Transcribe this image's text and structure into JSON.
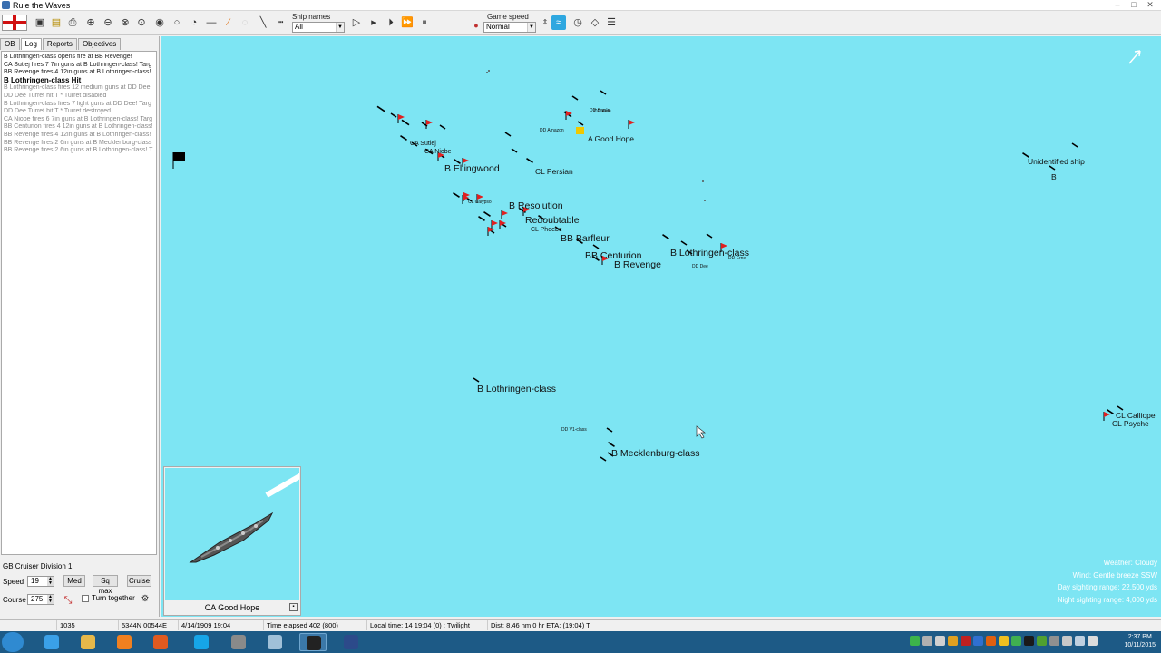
{
  "window": {
    "title": "Rule the Waves"
  },
  "toolbar": {
    "ship_names_label": "Ship names",
    "ship_names_value": "All",
    "game_speed_label": "Game speed",
    "game_speed_value": "Normal"
  },
  "left_panel": {
    "tabs": [
      "OB",
      "Log",
      "Reports",
      "Objectives"
    ],
    "active_tab": "Log",
    "log": [
      {
        "text": "B Lothringen-class opens fire at BB Revenge!",
        "style": "dark"
      },
      {
        "text": "CA Sutlej fires 7 7in guns at B Lothringen-class! Targ",
        "style": "dark"
      },
      {
        "text": "BB Revenge fires 4 12in guns at B Lothringen-class!",
        "style": "dark"
      },
      {
        "text": "B Lothringen-class Hit",
        "style": "bold"
      },
      {
        "text": "B Lothringen-class fires 12 medium guns at DD Dee!",
        "style": "grey"
      },
      {
        "text": "DD Dee Turret hit T * Turret disabled",
        "style": "grey"
      },
      {
        "text": "B Lothringen-class fires 7 light guns at DD Dee! Targ",
        "style": "grey"
      },
      {
        "text": "DD Dee Turret hit T * Turret destroyed",
        "style": "grey"
      },
      {
        "text": "CA Niobe fires 6 7in guns at B Lothringen-class! Targ",
        "style": "grey"
      },
      {
        "text": "BB Centurion fires 4 12in guns at B Lothringen-class!",
        "style": "grey"
      },
      {
        "text": "BB Revenge fires 4 12in guns at B Lothringen-class!",
        "style": "grey"
      },
      {
        "text": "BB Revenge fires 2 6in guns at B Mecklenburg-class",
        "style": "grey"
      },
      {
        "text": "BB Revenge fires 2 6in guns at B Lothringen-class! T",
        "style": "grey"
      }
    ],
    "division": "GB Cruiser Division 1",
    "speed_label": "Speed",
    "speed_value": "19",
    "course_label": "Course",
    "course_value": "275",
    "btn_med": "Med",
    "btn_sqmax": "Sq max",
    "btn_cruise": "Cruise",
    "turn_together": "Turn together"
  },
  "map": {
    "labels": [
      {
        "text": "B Ellingwood",
        "size": "big"
      },
      {
        "text": "CL Persian",
        "size": "mid"
      },
      {
        "text": "A Good Hope",
        "size": "mid"
      },
      {
        "text": "B Resolution",
        "size": "big"
      },
      {
        "text": "Redoubtable",
        "size": "big"
      },
      {
        "text": "BB Barfleur",
        "size": "big"
      },
      {
        "text": "BB Centurion",
        "size": "big"
      },
      {
        "text": "B Revenge",
        "size": "big"
      },
      {
        "text": "B Lothringen-class",
        "size": "big"
      },
      {
        "text": "Unidentified ship",
        "size": "mid"
      },
      {
        "text": "B",
        "size": "mid"
      },
      {
        "text": "B Lothringen-class",
        "size": "big"
      },
      {
        "text": "B Mecklenburg-class",
        "size": "big"
      },
      {
        "text": "CL Calliope",
        "size": "mid"
      },
      {
        "text": "CL Psyche",
        "size": "mid"
      },
      {
        "text": "CA Sutlej",
        "size": "small"
      },
      {
        "text": "CA Niobe",
        "size": "small"
      },
      {
        "text": "CL Phoebe",
        "size": "small"
      },
      {
        "text": "DD Dee",
        "size": "tiny"
      },
      {
        "text": "DD Erne",
        "size": "tiny"
      },
      {
        "text": "DD Kale",
        "size": "tiny"
      },
      {
        "text": "DD Swale",
        "size": "tiny"
      },
      {
        "text": "DD Amazon",
        "size": "tiny"
      },
      {
        "text": "DD V1-class",
        "size": "tiny"
      },
      {
        "text": "CL Calypso",
        "size": "tiny"
      }
    ]
  },
  "preview": {
    "caption": "CA Good Hope"
  },
  "weather": [
    "Weather: Cloudy",
    "Wind: Gentle breeze  SSW",
    "Day sighting range: 22,500 yds",
    "Night sighting range: 4,000 yds"
  ],
  "status": {
    "time_code": "1035",
    "position": "5344N 00544E",
    "date": "4/14/1909 19:04",
    "elapsed": "Time elapsed 402 (800)",
    "local_time": "Local time: 14 19:04 (0) : Twilight",
    "dist": "Dist: 8.46 nm 0 hr ETA: (19:04) T"
  },
  "clock": {
    "time": "2:37 PM",
    "date": "10/11/2015"
  },
  "colors": {
    "sea": "#7de5f3",
    "flag_red": "#e02020",
    "flag_yellow": "#f0c800"
  }
}
